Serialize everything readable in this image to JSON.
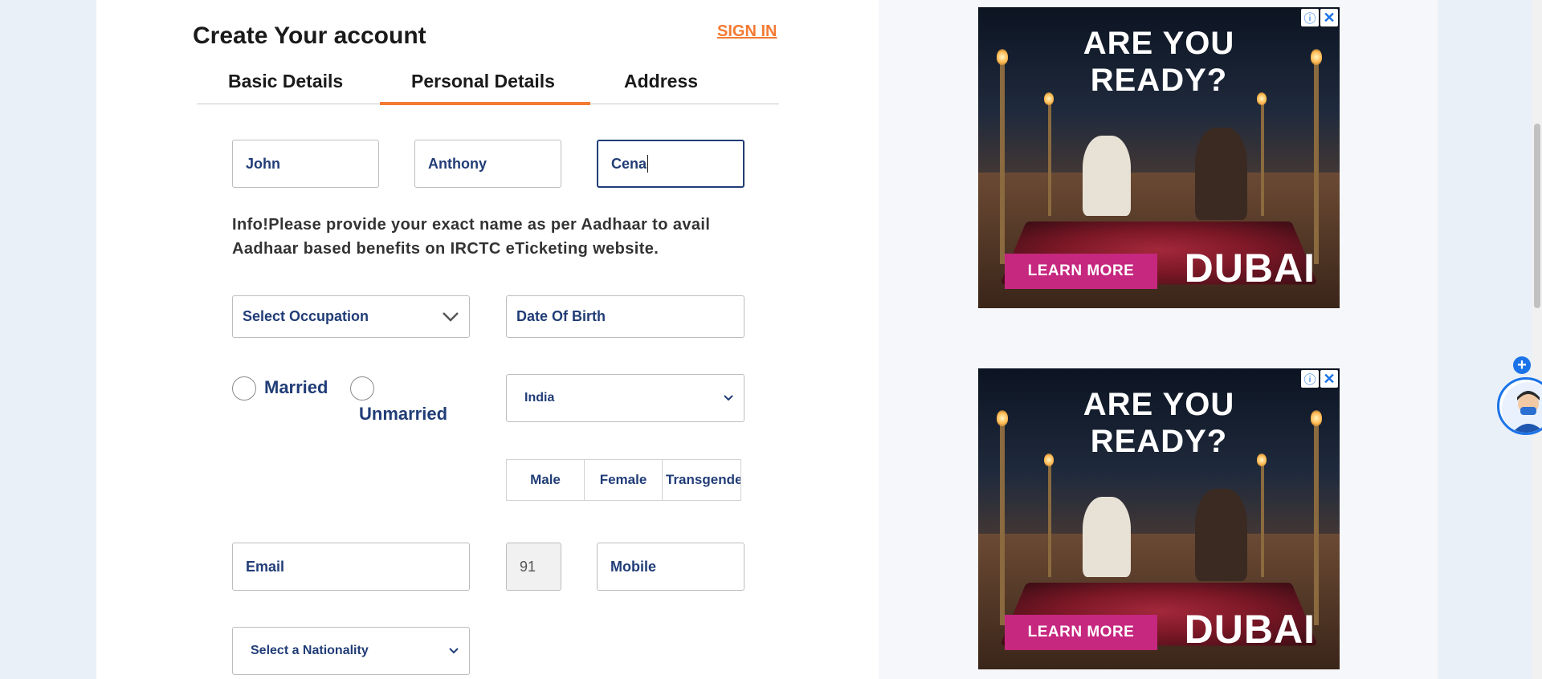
{
  "form": {
    "title": "Create Your account",
    "signin_label": "SIGN IN",
    "tabs": [
      {
        "label": "Basic Details"
      },
      {
        "label": "Personal Details"
      },
      {
        "label": "Address"
      }
    ],
    "active_tab": "Personal Details",
    "first_name": "John",
    "middle_name": "Anthony",
    "last_name": "Cena",
    "info_text": "Info!Please provide your exact name as per Aadhaar to avail Aadhaar based benefits on IRCTC eTicketing website.",
    "occupation_placeholder": "Select Occupation",
    "dob_placeholder": "Date Of Birth",
    "marital": {
      "married_label": "Married",
      "unmarried_label": "Unmarried"
    },
    "country_value": "India",
    "gender_options": [
      "Male",
      "Female",
      "Transgender"
    ],
    "email_placeholder": "Email",
    "isd_code": "91",
    "mobile_placeholder": "Mobile",
    "nationality_placeholder": "Select a Nationality"
  },
  "ads": [
    {
      "headline_line1": "ARE YOU",
      "headline_line2": "READY?",
      "cta": "LEARN MORE",
      "brand": "DUBAI",
      "info_icon": "info-icon",
      "close_icon": "close-icon"
    },
    {
      "headline_line1": "ARE YOU",
      "headline_line2": "READY?",
      "cta": "LEARN MORE",
      "brand": "DUBAI",
      "info_icon": "info-icon",
      "close_icon": "close-icon"
    }
  ],
  "colors": {
    "accent": "#f47a33",
    "field_text": "#213d77",
    "ad_cta": "#c6277f"
  }
}
